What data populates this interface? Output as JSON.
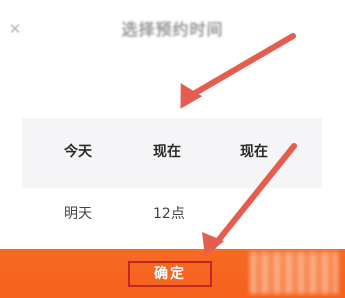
{
  "dialog": {
    "title": "选择预约时间",
    "close_icon": "close-icon"
  },
  "picker": {
    "columns": [
      {
        "selected": "今天",
        "next": "明天"
      },
      {
        "selected": "现在",
        "next": "12点"
      },
      {
        "selected": "现在",
        "next": ""
      }
    ]
  },
  "confirm": {
    "label": "确定"
  },
  "colors": {
    "accent": "#f4621d",
    "annotation_arrow": "#e45d4e",
    "highlight_box": "#c1262a"
  }
}
